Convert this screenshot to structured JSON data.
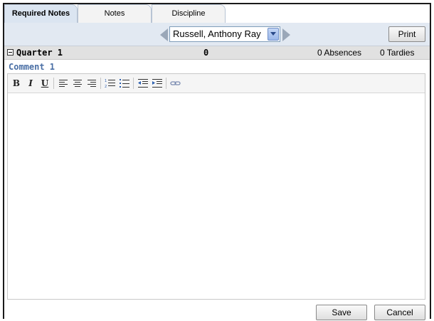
{
  "tabs": [
    {
      "label": "Required Notes",
      "active": true
    },
    {
      "label": "Notes",
      "active": false
    },
    {
      "label": "Discipline",
      "active": false
    }
  ],
  "navigation": {
    "student_selected": "Russell, Anthony Ray",
    "print_label": "Print"
  },
  "quarter": {
    "title": "Quarter 1",
    "count": "0",
    "absences": "0 Absences",
    "tardies": "0 Tardies"
  },
  "comment": {
    "label": "Comment 1",
    "toolbar": {
      "bold": "B",
      "italic": "I",
      "underline": "U"
    },
    "icons": [
      "bold-icon",
      "italic-icon",
      "underline-icon",
      "align-left-icon",
      "align-center-icon",
      "align-right-icon",
      "ordered-list-icon",
      "unordered-list-icon",
      "outdent-icon",
      "indent-icon",
      "link-icon"
    ],
    "body_text": ""
  },
  "actions": {
    "save_label": "Save",
    "cancel_label": "Cancel"
  },
  "colors": {
    "tab_active_bg": "#dbe5f1",
    "nav_bg": "#e2e9f2",
    "comment_label": "#4a6fa5",
    "quarter_bg": "#e1e1e1"
  }
}
